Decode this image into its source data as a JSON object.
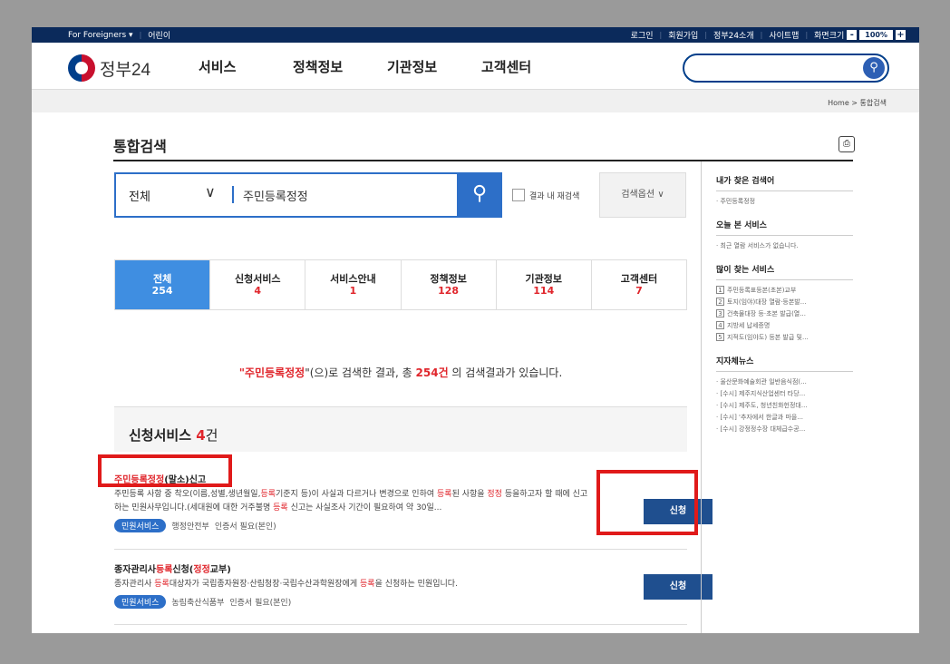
{
  "topbar": {
    "foreigners": "For Foreigners ▾",
    "kids": "어린이",
    "links": [
      "로그인",
      "회원가입",
      "정부24소개",
      "사이트맵"
    ],
    "zoom_label": "화면크기",
    "zoom_minus": "-",
    "zoom_value": "100%",
    "zoom_plus": "+"
  },
  "header": {
    "logo_text": "정부24",
    "menu": [
      "서비스",
      "정책정보",
      "기관정보",
      "고객센터"
    ],
    "search_placeholder": ""
  },
  "breadcrumb": "Home > 통합검색",
  "page_title": "통합검색",
  "search": {
    "scope": "전체",
    "query": "주민등록정정",
    "within_label": "결과 내 재검색",
    "options_label": "검색옵션 ∨"
  },
  "tabs": [
    {
      "label": "전체",
      "count": "254"
    },
    {
      "label": "신청서비스",
      "count": "4"
    },
    {
      "label": "서비스안내",
      "count": "1"
    },
    {
      "label": "정책정보",
      "count": "128"
    },
    {
      "label": "기관정보",
      "count": "114"
    },
    {
      "label": "고객센터",
      "count": "7"
    }
  ],
  "result_message": {
    "open_quote": "\"",
    "keyword": "주민등록정정",
    "mid": "\"(으)로 검색한 결과, 총 ",
    "count": "254건",
    "tail": " 의 검색결과가 있습니다."
  },
  "section": {
    "title": "신청서비스 ",
    "count": "4",
    "unit": "건"
  },
  "items": [
    {
      "title_hl": "주민등록정정",
      "title_rest": "(말소)신고",
      "desc_1": "주민등록 사항 중 착오(이름,성별,생년월일,",
      "desc_hl1": "등록",
      "desc_2": "기준지 등)이 사실과 다르거나 변경으로 인하여 ",
      "desc_hl2": "등록",
      "desc_3": "된 사항을 ",
      "desc_hl3": "정정",
      "desc_4": " 등을하고자 할 때에 신고하는 민원사무입니다.(세대원에 대한 거주불명 ",
      "desc_hl4": "등록",
      "desc_5": " 신고는 사실조사 기간이 필요하여 약 30일...",
      "badge": "민원서비스",
      "org": "행정안전부",
      "cert": "인증서 필요(본인)",
      "apply": "신청"
    },
    {
      "title_a": "종자관리사",
      "title_hl1": "등록",
      "title_b": "신청(",
      "title_hl2": "정정",
      "title_c": "교부)",
      "desc_1": "종자관리사 ",
      "desc_hl1": "등록",
      "desc_2": "대상자가 국립종자원장·산림청장·국립수산과학원장에게 ",
      "desc_hl2": "등록",
      "desc_3": "을 신청하는 민원입니다.",
      "badge": "민원서비스",
      "org": "농림축산식품부",
      "cert": "인증서 필요(본인)",
      "apply": "신청"
    }
  ],
  "sidebar": {
    "recent_search_title": "내가 찾은 검색어",
    "recent_search": [
      "주민등록정정"
    ],
    "today_title": "오늘 본 서비스",
    "today": [
      "최근 열람 서비스가 없습니다."
    ],
    "popular_title": "많이 찾는 서비스",
    "popular": [
      {
        "num": "1",
        "label": "주민등록표등본(초본)교부"
      },
      {
        "num": "2",
        "label": "토지(임야)대장 열람·등본발..."
      },
      {
        "num": "3",
        "label": "건축물대장 등·초본 발급(열..."
      },
      {
        "num": "4",
        "label": "지방세 납세증명"
      },
      {
        "num": "5",
        "label": "지적도(임야도) 등본 발급 및..."
      }
    ],
    "news_title": "지자체뉴스",
    "news": [
      "울산문화예술회관 일반음식점(...",
      "[수시] 제주지식산업센터 타당...",
      "[수시] 제주도, 청년친화헌정대...",
      "[수시] '추자에서 한글과 마을...",
      "[수시] 강정정수장 대체급수공..."
    ]
  }
}
